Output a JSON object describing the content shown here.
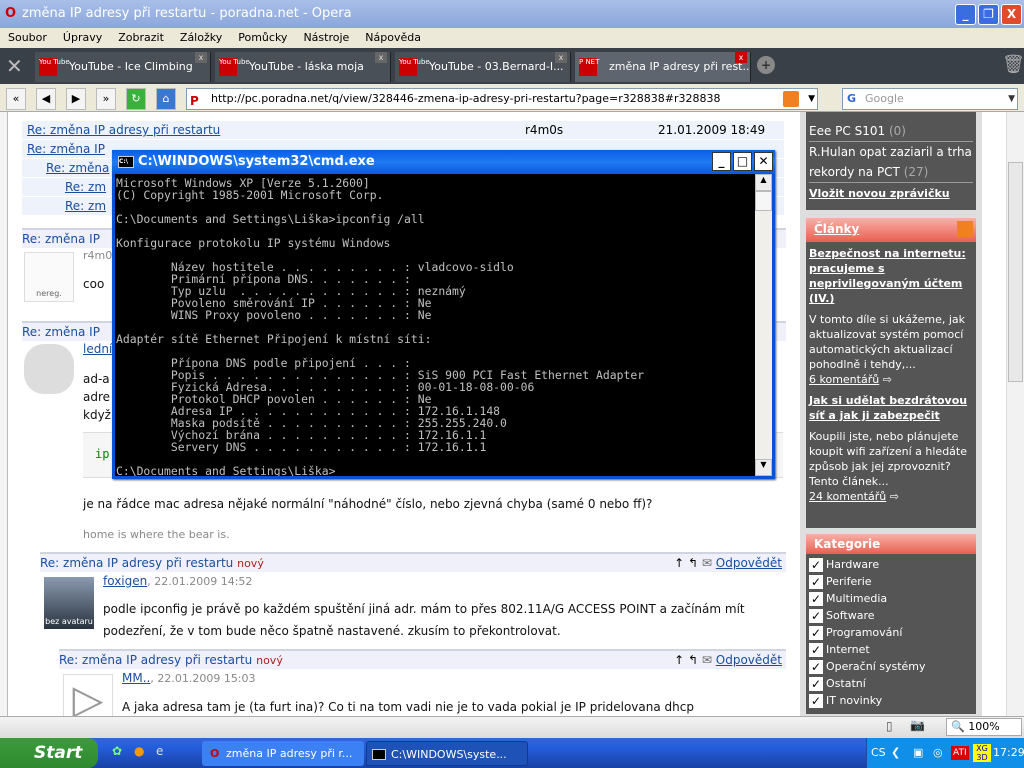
{
  "window": {
    "title": "změna IP adresy při restartu - poradna.net - Opera"
  },
  "menu": [
    "Soubor",
    "Úpravy",
    "Zobrazit",
    "Záložky",
    "Pomůcky",
    "Nástroje",
    "Nápověda"
  ],
  "tabs": [
    {
      "label": "YouTube - Ice Climbing"
    },
    {
      "label": "YouTube - láska moja"
    },
    {
      "label": "YouTube - 03.Bernard-I..."
    },
    {
      "label": "změna IP adresy při rest..."
    }
  ],
  "address": {
    "url": "http://pc.poradna.net/q/view/328446-zmena-ip-adresy-pri-restartu?page=r328838#r328838",
    "search_placeholder": "Google"
  },
  "thread_table": [
    {
      "title": "Re: změna IP adresy při restartu",
      "author": "r4m0s",
      "date": "21.01.2009 18:49"
    },
    {
      "title": "Re: změna IP"
    },
    {
      "title": "Re: změna"
    },
    {
      "title": "Re: zm"
    },
    {
      "title": "Re: zm"
    }
  ],
  "posts_partial": [
    {
      "title": "Re: změna IP",
      "author": "r4m0",
      "text": "coo",
      "avatar": "nereg."
    },
    {
      "title": "Re: změna IP",
      "author": "lední",
      "lines": [
        "ad-a",
        "adre",
        "když"
      ],
      "code": "ip"
    }
  ],
  "post_bear": {
    "text": "je na řádce mac adresa nějaké normální \"náhodné\" číslo, nebo zjevná chyba (samé 0 nebo ff)?",
    "signature": "home is where the bear is."
  },
  "posts": [
    {
      "title": "Re: změna IP adresy při restartu",
      "badge": "nový",
      "reply": "Odpovědět",
      "author": "foxigen",
      "date": ", 22.01.2009 14:52",
      "avatar": "bez avataru",
      "text": "podle ipconfig je právě po každém spuštění jiná adr. mám to přes 802.11A/G ACCESS POINT a začínám mít podezření, že v tom bude něco špatně nastavené. zkusím to překontrolovat."
    },
    {
      "title": "Re: změna IP adresy při restartu",
      "badge": "nový",
      "reply": "Odpovědět",
      "author": "MM..",
      "date": ", 22.01.2009 15:03",
      "text": "A jaka adresa tam je (ta furt ina)? Co ti na tom vadi nie je to vada pokial je IP pridelovana dhcp"
    }
  ],
  "sidebar": {
    "news": [
      {
        "title": "Eee PC S101",
        "count": "(0)"
      },
      {
        "title": "R.Hulan opat zaziaril a trha rekordy na PCT",
        "count": "(27)"
      }
    ],
    "add_news": "Vložit novou zprávičku",
    "articles_header": "Články",
    "articles": [
      {
        "title": "Bezpečnost na internetu: pracujeme s neprivilegovaným účtem (IV.)",
        "perex": "V tomto díle si ukážeme, jak aktualizovat systém pomocí automatických aktualizací pohodlně i tehdy,...",
        "comments": "6 komentářů"
      },
      {
        "title": "Jak si udělat bezdrátovou síť a jak ji zabezpečit",
        "perex": "Koupili jste, nebo plánujete koupit wifi zařízení a hledáte způsob jak jej zprovoznit? Tento článek...",
        "comments": "24 komentářů"
      }
    ],
    "categories_header": "Kategorie",
    "categories": [
      "Hardware",
      "Periferie",
      "Multimedia",
      "Software",
      "Programování",
      "Internet",
      "Operační systémy",
      "Ostatní",
      "IT novinky"
    ]
  },
  "status": {
    "zoom": "100%"
  },
  "cmd": {
    "title": "C:\\WINDOWS\\system32\\cmd.exe",
    "output": "Microsoft Windows XP [Verze 5.1.2600]\n(C) Copyright 1985-2001 Microsoft Corp.\n\nC:\\Documents and Settings\\Liška>ipconfig /all\n\nKonfigurace protokolu IP systému Windows\n\n        Název hostitele . . . . . . . . . : vladcovo-sidlo\n        Primární přípona DNS. . . . . . . :\n        Typ uzlu  . . . . . . . . . . . . : neznámý\n        Povoleno směrování IP . . . . . . : Ne\n        WINS Proxy povoleno . . . . . . . : Ne\n\nAdaptér sítě Ethernet Připojení k místní síti:\n\n        Přípona DNS podle připojení . . . :\n        Popis . . . . . . . . . . . . . . : SiS 900 PCI Fast Ethernet Adapter\n        Fyzická Adresa. . . . . . . . . . : 00-01-18-08-00-06\n        Protokol DHCP povolen . . . . . . : Ne\n        Adresa IP . . . . . . . . . . . . : 172.16.1.148\n        Maska podsítě . . . . . . . . . . : 255.255.240.0\n        Výchozí brána . . . . . . . . . . : 172.16.1.1\n        Servery DNS . . . . . . . . . . . : 172.16.1.1\n\nC:\\Documents and Settings\\Liška>"
  },
  "taskbar": {
    "start": "Start",
    "items": [
      "změna IP adresy při r...",
      "C:\\WINDOWS\\syste..."
    ],
    "lang": "CS",
    "clock": "17:29"
  }
}
